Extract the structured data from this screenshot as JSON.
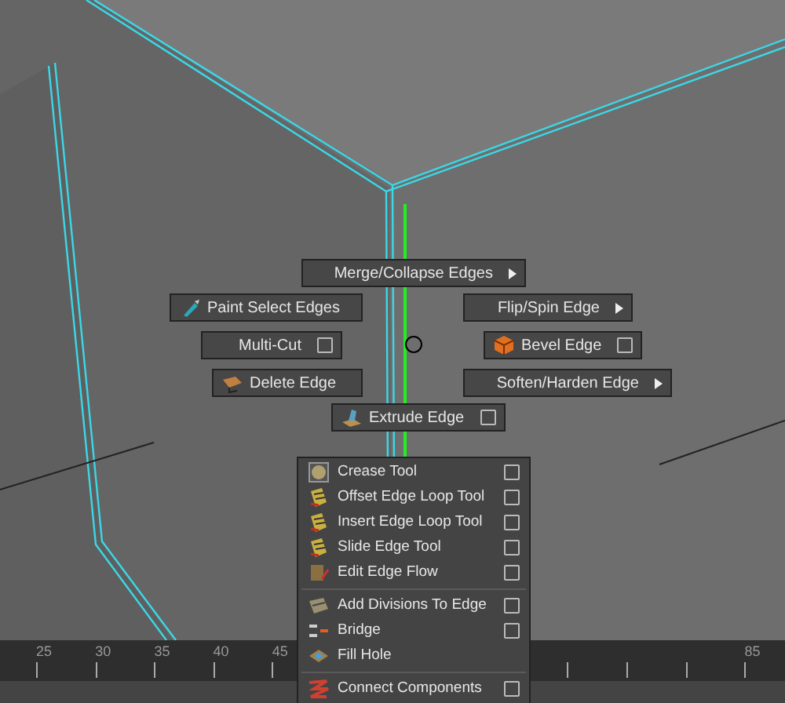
{
  "marking_menu": [
    {
      "label": "Merge/Collapse Edges",
      "kind": "submenu"
    },
    {
      "label": "Paint Select Edges",
      "kind": "plain"
    },
    {
      "label": "Flip/Spin Edge",
      "kind": "submenu"
    },
    {
      "label": "Multi-Cut",
      "kind": "option"
    },
    {
      "label": "Bevel Edge",
      "kind": "option"
    },
    {
      "label": "Delete Edge",
      "kind": "plain"
    },
    {
      "label": "Soften/Harden Edge",
      "kind": "submenu"
    },
    {
      "label": "Extrude Edge",
      "kind": "option"
    }
  ],
  "dropdown_menu": [
    [
      {
        "label": "Crease Tool",
        "option_box": true
      },
      {
        "label": "Offset Edge Loop Tool",
        "option_box": true
      },
      {
        "label": "Insert Edge Loop Tool",
        "option_box": true
      },
      {
        "label": "Slide Edge Tool",
        "option_box": true
      },
      {
        "label": "Edit Edge Flow",
        "option_box": true
      }
    ],
    [
      {
        "label": "Add Divisions To Edge",
        "option_box": true
      },
      {
        "label": "Bridge",
        "option_box": true
      },
      {
        "label": "Fill Hole",
        "option_box": false
      }
    ],
    [
      {
        "label": "Connect Components",
        "option_box": true
      }
    ]
  ],
  "timeline": {
    "labels": [
      "25",
      "30",
      "35",
      "40",
      "45",
      "85"
    ]
  }
}
